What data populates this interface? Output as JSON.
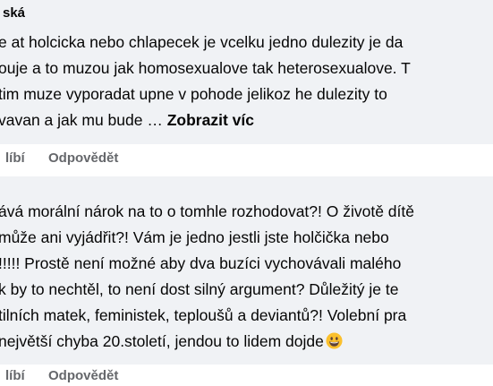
{
  "comments": [
    {
      "author": "ská",
      "lines": [
        "e at holcicka nebo chlapecek je vcelku jedno dulezity je da",
        "ouje a to muzou jak homosexualove tak heterosexualove. T",
        "tim muze vyporadat upne v pohode jelikoz he dulezity to",
        "vavan a jak mu bude … "
      ],
      "see_more": "Zobrazit víc",
      "like_label": "líbí",
      "reply_label": "Odpovědět"
    },
    {
      "lines": [
        "ává morální nárok na to o tomhle rozhodovat?! O životě dítě",
        "může ani vyjádřit?! Vám je jedno jestli jste holčička nebo",
        "!!!!! Prostě není možné aby dva buzíci vychovávali malého",
        "k by to nechtěl, to není dost silný argument? Důležitý je te",
        "tilních matek, feministek, teploušů a deviantů?! Volební pra",
        " největší chyba 20.století, jendou to lidem dojde"
      ],
      "emoji": "grinning-face-emoji",
      "like_label": "líbí",
      "reply_label": "Odpovědět"
    }
  ],
  "colors": {
    "bubble": "#f0f2f5",
    "text": "#050505",
    "secondary_text": "#65676b",
    "emoji_face": "#fbc02d"
  }
}
